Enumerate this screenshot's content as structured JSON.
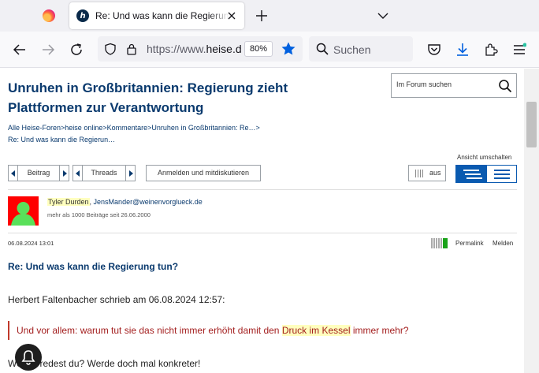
{
  "browser": {
    "tab_title": "Re: Und was kann die Regierung tun?",
    "heise_icon_letter": "h",
    "url_prefix": "https://www.",
    "url_host": "heise.de/forum/heise-online",
    "zoom": "80%",
    "search_placeholder": "Suchen",
    "icons": [
      "firefox-icon",
      "heise-favicon",
      "close-icon",
      "plus-icon",
      "chevron-down-icon",
      "back-arrow-icon",
      "forward-arrow-icon",
      "reload-icon",
      "shield-icon",
      "lock-icon",
      "star-icon",
      "search-icon",
      "pocket-icon",
      "download-icon",
      "extensions-icon",
      "hamburger-menu-icon"
    ],
    "accent_color": "#0060df"
  },
  "page": {
    "thread_title": "Unruhen in Großbritannien: Regierung zieht Plattformen zur Verantwortung",
    "forum_search_placeholder": "Im Forum suchen",
    "breadcrumb": [
      "Alle Heise-Foren",
      "heise online",
      "Kommentare",
      "Unruhen in Großbritannien: Re…",
      "Re: Und was kann die Regierun…"
    ],
    "breadcrumb_sep": ">",
    "view_toggle_label": "Ansicht umschalten",
    "pager_posts_label": "Beitrag",
    "pager_threads_label": "Threads",
    "login_button": "Anmelden und mitdiskutieren",
    "aus_button": "aus",
    "brand_color": "#0a3a6e"
  },
  "post": {
    "author": "Tyler Durden",
    "author_sep": ", ",
    "author_email": "JensMander@weinenvorglueck.de",
    "author_meta": "mehr als 1000 Beiträge seit 26.06.2000",
    "date": "06.08.2024 13:01",
    "permalink_label": "Permalink",
    "report_label": "Melden",
    "subject": "Re: Und was kann die Regierung tun?",
    "intro": "Herbert Faltenbacher schrieb am 06.08.2024 12:57:",
    "quote_before": "Und vor allem: warum tut sie das nicht immer erhöht damit den ",
    "quote_highlight": "Druck im Kessel",
    "quote_after": " immer mehr?",
    "text": "Wovon redest du? Werde doch mal konkreter!",
    "rating_color": "#1aa31a"
  }
}
